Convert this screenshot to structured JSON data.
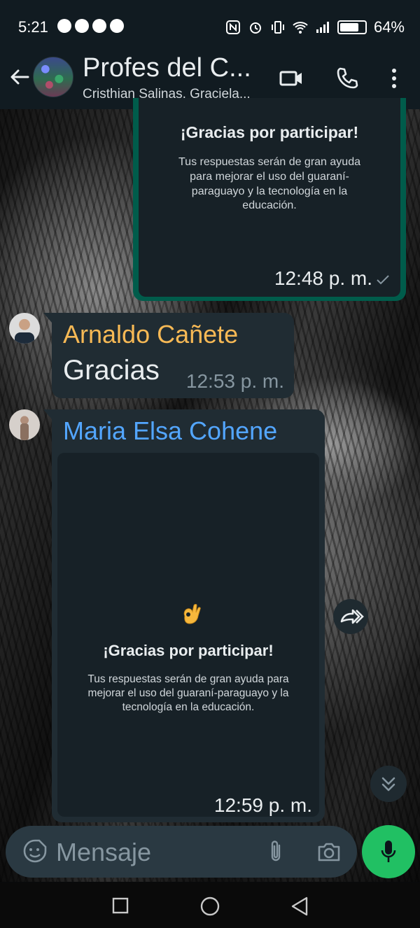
{
  "status_bar": {
    "time": "5:21",
    "battery": "64%"
  },
  "header": {
    "title": "Profes del C...",
    "subtitle": "Cristhian Salinas, Graciela..."
  },
  "messages": [
    {
      "type": "outgoing-card",
      "card_title": "¡Gracias por participar!",
      "card_body": "Tus respuestas serán de gran ayuda para mejorar el uso del guaraní-paraguayo y la tecnología en la educación.",
      "time": "12:48 p. m."
    },
    {
      "type": "incoming-text",
      "sender": "Arnaldo Cañete",
      "sender_color": "#f7b955",
      "text": "Gracias",
      "time": "12:53 p. m."
    },
    {
      "type": "incoming-card",
      "sender": "Maria Elsa Cohene",
      "sender_color": "#53a6ff",
      "card_icon": "ok-hand-icon",
      "card_title": "¡Gracias por participar!",
      "card_body": "Tus respuestas serán de gran ayuda para mejorar el uso del guaraní-paraguayo y la tecnología en la educación.",
      "time": "12:59 p. m."
    }
  ],
  "composer": {
    "placeholder": "Mensaje"
  },
  "colors": {
    "accent_green": "#21c063",
    "own_bubble": "#005c4b",
    "incoming_bubble": "#202c33",
    "header_bg": "#111b21"
  }
}
